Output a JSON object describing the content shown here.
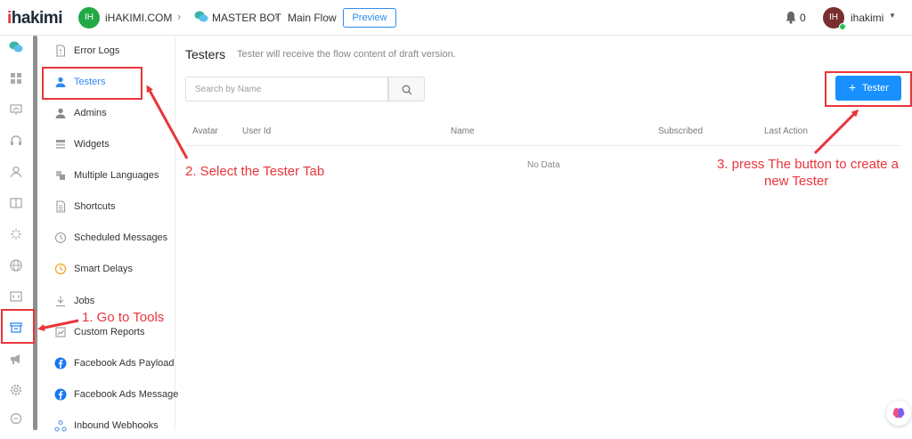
{
  "topbar": {
    "logo": "hakimi",
    "logo_accent": "i",
    "workspace_initials": "IH",
    "workspace_name": "iHAKIMI.COM",
    "bot_name": "MASTER BOT",
    "flow_name": "Main Flow",
    "preview_label": "Preview",
    "notification_count": "0",
    "user_initials": "IH",
    "user_name": "ihakimi"
  },
  "rail": {
    "icons": [
      "chat-bubbles-icon",
      "dashboard-icon",
      "presentation-icon",
      "headset-icon",
      "user-icon",
      "book-icon",
      "sparkle-icon",
      "globe-icon",
      "code-icon",
      "tools-icon",
      "megaphone-icon",
      "settings-icon",
      "chat-icon"
    ]
  },
  "menu": {
    "items": [
      {
        "label": "Error Logs",
        "icon": "file-icon"
      },
      {
        "label": "Testers",
        "icon": "user-icon"
      },
      {
        "label": "Admins",
        "icon": "user-icon"
      },
      {
        "label": "Widgets",
        "icon": "widget-icon"
      },
      {
        "label": "Multiple Languages",
        "icon": "translate-icon"
      },
      {
        "label": "Shortcuts",
        "icon": "document-icon"
      },
      {
        "label": "Scheduled Messages",
        "icon": "clock-icon"
      },
      {
        "label": "Smart Delays",
        "icon": "clock-icon"
      },
      {
        "label": "Jobs",
        "icon": "download-icon"
      },
      {
        "label": "Custom Reports",
        "icon": "report-icon"
      },
      {
        "label": "Facebook Ads Payload",
        "icon": "facebook-icon"
      },
      {
        "label": "Facebook Ads Message",
        "icon": "facebook-icon"
      },
      {
        "label": "Inbound Webhooks",
        "icon": "webhook-icon"
      }
    ]
  },
  "main": {
    "title": "Testers",
    "subtitle": "Tester will receive the flow content of draft version.",
    "search_placeholder": "Search by Name",
    "add_label": "Tester",
    "columns": [
      "Avatar",
      "User Id",
      "Name",
      "Subscribed",
      "Last Action"
    ],
    "empty_text": "No Data"
  },
  "annotations": {
    "step1": "1. Go to Tools",
    "step2": "2. Select the Tester Tab",
    "step3_line1": "3. press The button to create a",
    "step3_line2": "new Tester"
  },
  "colors": {
    "accent": "#1890ff",
    "annotation": "#e8353b",
    "logo_red": "#e0353f",
    "workspace_green": "#22a845"
  }
}
